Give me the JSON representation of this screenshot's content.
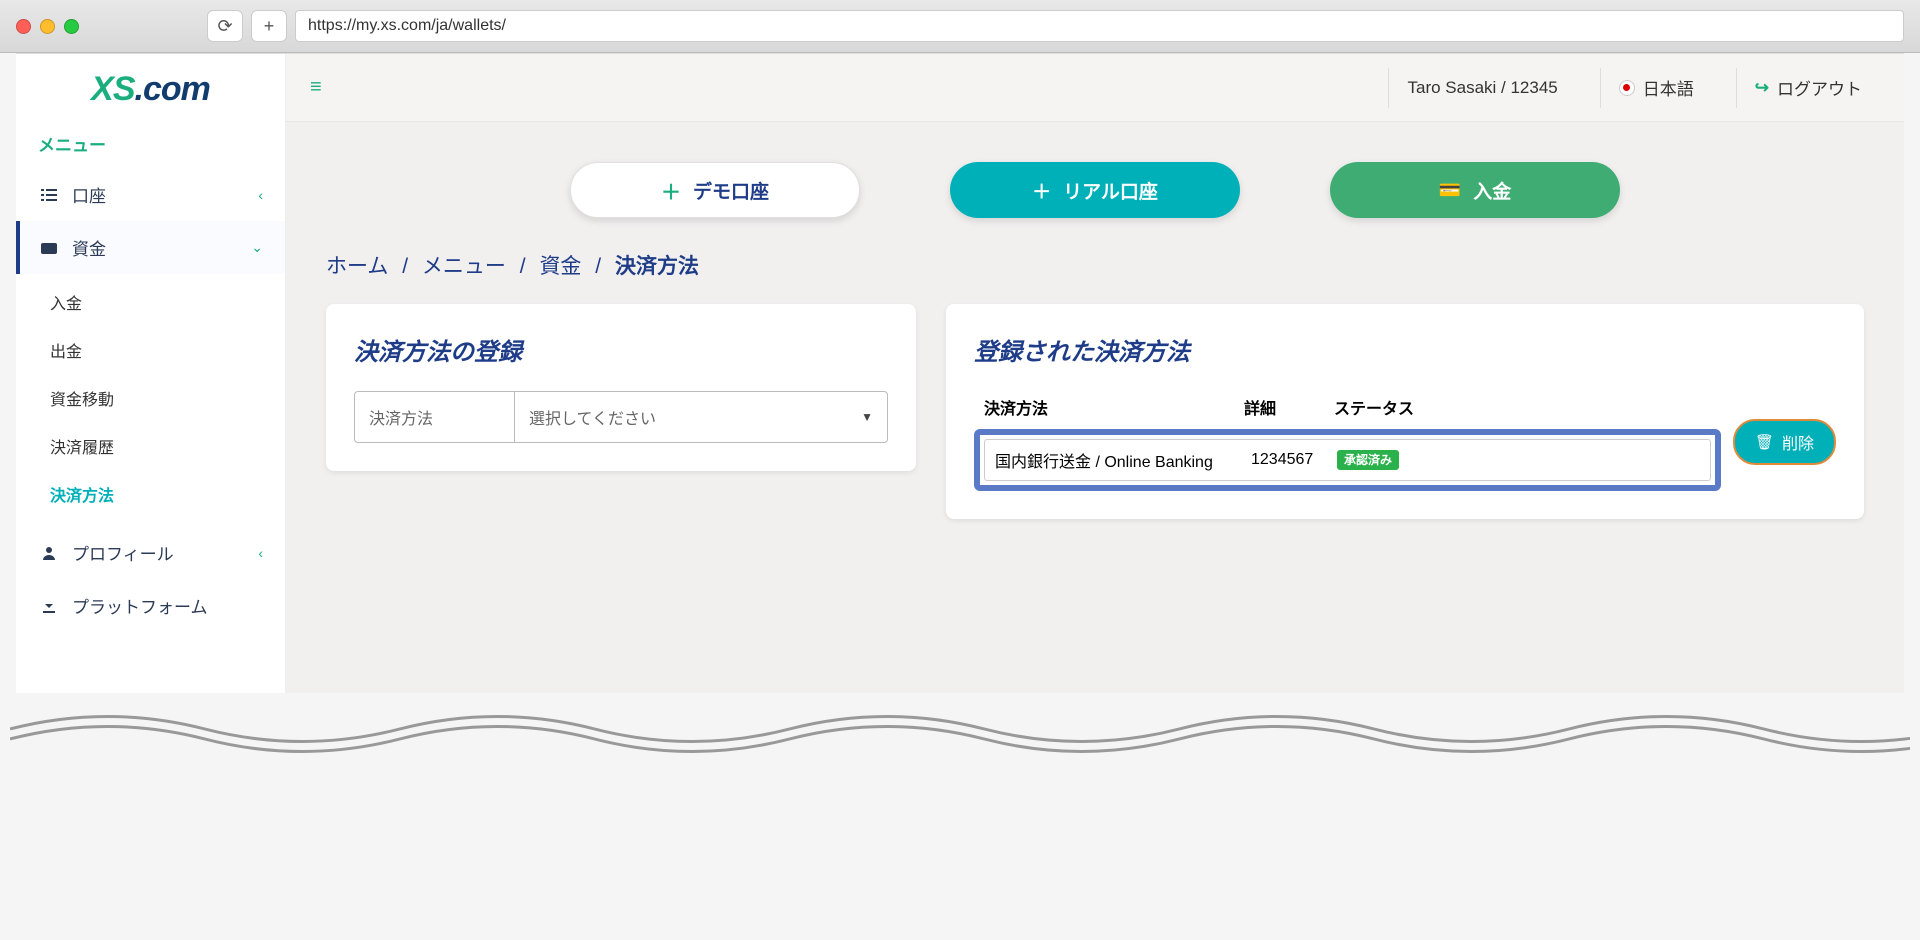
{
  "browser": {
    "url": "https://my.xs.com/ja/wallets/"
  },
  "logo": {
    "xs": "XS",
    "com": ".com"
  },
  "sidebar": {
    "menu_title": "メニュー",
    "items": [
      {
        "label": "口座"
      },
      {
        "label": "資金"
      },
      {
        "label": "プロフィール"
      },
      {
        "label": "プラットフォーム"
      }
    ],
    "funds_sub": [
      {
        "label": "入金"
      },
      {
        "label": "出金"
      },
      {
        "label": "資金移動"
      },
      {
        "label": "決済履歴"
      },
      {
        "label": "決済方法"
      }
    ]
  },
  "topbar": {
    "user": "Taro Sasaki / 12345",
    "language": "日本語",
    "logout": "ログアウト"
  },
  "actions": {
    "demo": "デモ口座",
    "real": "リアル口座",
    "deposit": "入金"
  },
  "breadcrumb": {
    "home": "ホーム",
    "menu": "メニュー",
    "funds": "資金",
    "current": "決済方法"
  },
  "register_card": {
    "title": "決済方法の登録",
    "field_label": "決済方法",
    "placeholder": "選択してください"
  },
  "registered_card": {
    "title": "登録された決済方法",
    "headers": {
      "method": "決済方法",
      "detail": "詳細",
      "status": "ステータス"
    },
    "row": {
      "method": "国内銀行送金 / Online Banking",
      "detail": "1234567",
      "status": "承認済み"
    },
    "delete": "削除"
  }
}
